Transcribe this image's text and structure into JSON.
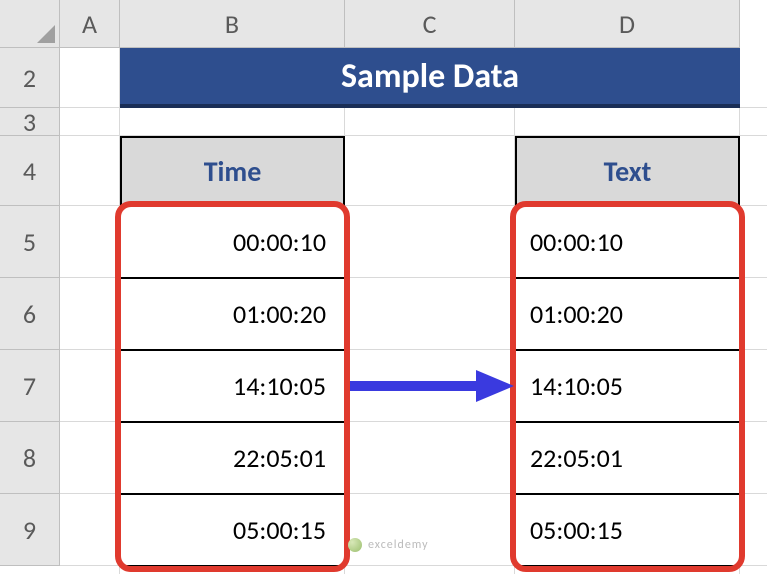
{
  "columns": [
    "A",
    "B",
    "C",
    "D"
  ],
  "rows": [
    "2",
    "3",
    "4",
    "5",
    "6",
    "7",
    "8",
    "9"
  ],
  "title": "Sample Data",
  "table1": {
    "header": "Time",
    "values": [
      "00:00:10",
      "01:00:20",
      "14:10:05",
      "22:05:01",
      "05:00:15"
    ]
  },
  "table2": {
    "header": "Text",
    "values": [
      "00:00:10",
      "01:00:20",
      "14:10:05",
      "22:05:01",
      "05:00:15"
    ]
  },
  "colors": {
    "title_bg": "#2e4e8e",
    "title_underline": "#1a2e56",
    "header_bg": "#d9d9d9",
    "header_fg": "#2e4e8e",
    "highlight": "#e03a2e",
    "arrow": "#3a3adf"
  },
  "watermark": "exceldemy",
  "chart_data": {
    "type": "table",
    "columns": [
      "Time",
      "Text"
    ],
    "rows": [
      [
        "00:00:10",
        "00:00:10"
      ],
      [
        "01:00:20",
        "01:00:20"
      ],
      [
        "14:10:05",
        "14:10:05"
      ],
      [
        "22:05:01",
        "22:05:01"
      ],
      [
        "05:00:15",
        "05:00:15"
      ]
    ],
    "title": "Sample Data"
  }
}
